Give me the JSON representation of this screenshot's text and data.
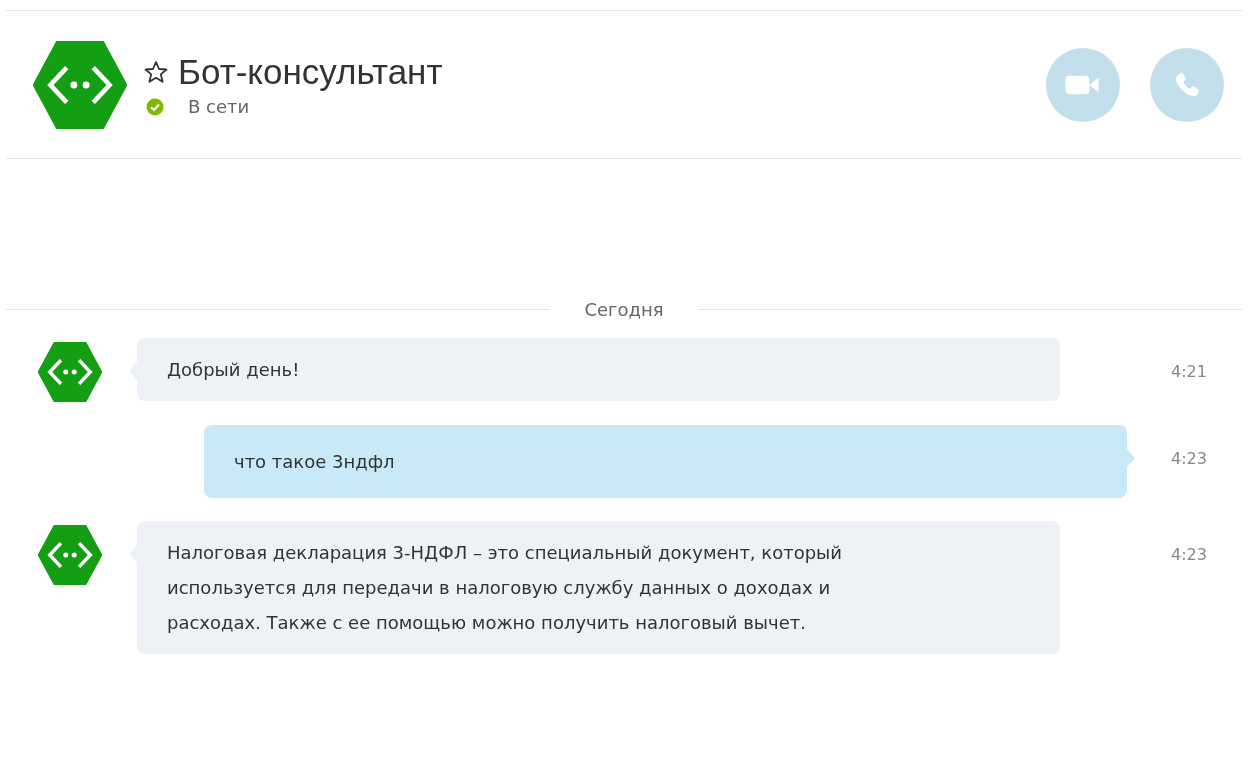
{
  "header": {
    "title": "Бот-консультант",
    "favorite": false,
    "status": "В сети",
    "online": true
  },
  "divider": "Сегодня",
  "messages": [
    {
      "kind": "incoming",
      "text": "Добрый день!",
      "time": "4:21"
    },
    {
      "kind": "outgoing",
      "text": "что такое 3ндфл",
      "time": "4:23"
    },
    {
      "kind": "incoming",
      "text": "Налоговая декларация 3-НДФЛ – это специальный документ, который\nиспользуется для передачи в налоговую службу данных о доходах и\nрасходах. Также с ее помощью можно получить налоговый вычет.",
      "time": "4:23"
    }
  ]
}
